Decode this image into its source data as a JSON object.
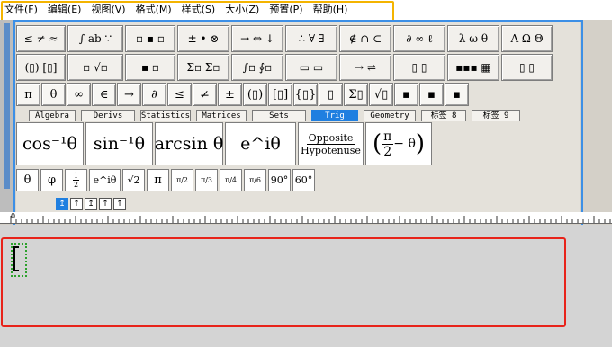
{
  "menu": [
    "文件(F)",
    "编辑(E)",
    "视图(V)",
    "格式(M)",
    "样式(S)",
    "大小(Z)",
    "预置(P)",
    "帮助(H)"
  ],
  "palette": {
    "row1": [
      "≤ ≠ ≈",
      "∫ ab ∵",
      "▫ ▪ ▫",
      "± • ⊗",
      "→ ⇔ ↓",
      "∴ ∀ ∃",
      "∉ ∩ ⊂",
      "∂ ∞ ℓ",
      "λ ω θ",
      "Λ Ω Θ"
    ],
    "row2": [
      "(▯) [▯]",
      "▫ √▫",
      "▪ ▫",
      "Σ▫ Σ▫",
      "∫▫ ∮▫",
      "▭ ▭",
      "→ ⇌",
      "▯ ▯",
      "▪▪▪ ▦",
      "▯ ▯"
    ],
    "row3": [
      "π",
      "θ",
      "∞",
      "∈",
      "→",
      "∂",
      "≤",
      "≠",
      "±",
      "(▯)",
      "[▯]",
      "{▯}",
      "▯",
      "Σ▯",
      "√▯",
      "▪",
      "▪",
      "▪"
    ],
    "tabs": [
      "Algebra",
      "Derivs",
      "Statistics",
      "Matrices",
      "Sets",
      "Trig",
      "Geometry",
      "标签 8",
      "标签 9"
    ],
    "active_tab": "Trig",
    "trig_large": {
      "cos_inv": "cos⁻¹θ",
      "sin_inv": "sin⁻¹θ",
      "arcsin": "arcsin θ",
      "exp_i_theta": "e^iθ",
      "opposite": "Opposite",
      "hypotenuse": "Hypotenuse",
      "pi_num": "π",
      "pi_den": "2",
      "minus_theta": "− θ"
    },
    "trig_small": {
      "theta": "θ",
      "phi": "φ",
      "half_num": "1",
      "half_den": "2",
      "exp": "e^iθ",
      "sqrt2": "√2",
      "pi": "π",
      "f1": "π/2",
      "f2": "π/3",
      "f3": "π/4",
      "f4": "π/6",
      "deg90": "90°",
      "deg60": "60°"
    }
  },
  "toolbar_glyphs": [
    "↥",
    "↑",
    "↥",
    "↑",
    "↑"
  ],
  "ruler_label": "0",
  "colors": {
    "highlight_menu": "#f4b400",
    "highlight_palette": "#3c8fe6",
    "highlight_editor": "#e8231a",
    "caret": "#2ca02c",
    "active_tab": "#1f7fe0"
  }
}
